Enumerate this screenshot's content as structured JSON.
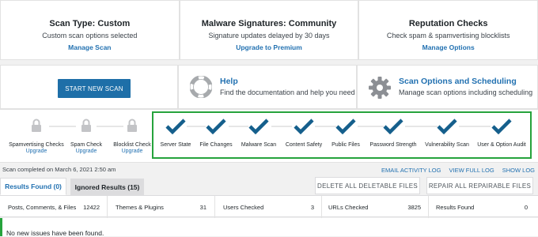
{
  "top_cards": [
    {
      "title": "Scan Type: Custom",
      "subtitle": "Custom scan options selected",
      "link": "Manage Scan"
    },
    {
      "title": "Malware Signatures: Community",
      "subtitle": "Signature updates delayed by 30 days",
      "link": "Upgrade to Premium"
    },
    {
      "title": "Reputation Checks",
      "subtitle": "Check spam & spamvertising blocklists",
      "link": "Manage Options"
    }
  ],
  "start_scan_label": "START NEW SCAN",
  "help": {
    "title": "Help",
    "subtitle": "Find the documentation and help you need"
  },
  "scan_options": {
    "title": "Scan Options and Scheduling",
    "subtitle": "Manage scan options including scheduling"
  },
  "steps": [
    {
      "label": "Spamvertising Checks",
      "sublabel": "Upgrade",
      "state": "locked"
    },
    {
      "label": "Spam Check",
      "sublabel": "Upgrade",
      "state": "locked"
    },
    {
      "label": "Blocklist Check",
      "sublabel": "Upgrade",
      "state": "locked"
    },
    {
      "label": "Server State",
      "state": "complete"
    },
    {
      "label": "File Changes",
      "state": "complete"
    },
    {
      "label": "Malware Scan",
      "state": "complete"
    },
    {
      "label": "Content Safety",
      "state": "complete"
    },
    {
      "label": "Public Files",
      "state": "complete"
    },
    {
      "label": "Password Strength",
      "state": "complete"
    },
    {
      "label": "Vulnerability Scan",
      "state": "complete"
    },
    {
      "label": "User & Option Audit",
      "state": "complete"
    }
  ],
  "status_text": "Scan completed on March 6, 2021 2:50 am",
  "log_links": [
    "EMAIL ACTIVITY LOG",
    "VIEW FULL LOG",
    "SHOW LOG"
  ],
  "tabs": {
    "results_found": "Results Found (0)",
    "ignored_results": "Ignored Results (15)"
  },
  "actions": {
    "delete_all": "DELETE ALL DELETABLE FILES",
    "repair_all": "REPAIR ALL REPAIRABLE FILES"
  },
  "stats": [
    {
      "label": "Posts, Comments, & Files",
      "value": "12422"
    },
    {
      "label": "Themes & Plugins",
      "value": "31"
    },
    {
      "label": "Users Checked",
      "value": "3"
    },
    {
      "label": "URLs Checked",
      "value": "3825"
    },
    {
      "label": "Results Found",
      "value": "0"
    }
  ],
  "notice": "No new issues have been found.",
  "colors": {
    "accent": "#2271b1",
    "button": "#1e6fa8",
    "check": "#155f8c",
    "success": "#26a33c",
    "lock": "#c3c4c7"
  },
  "icons": {
    "help": "lifebuoy-icon",
    "settings": "gear-icon",
    "lock": "lock-icon",
    "check": "checkmark-icon"
  }
}
